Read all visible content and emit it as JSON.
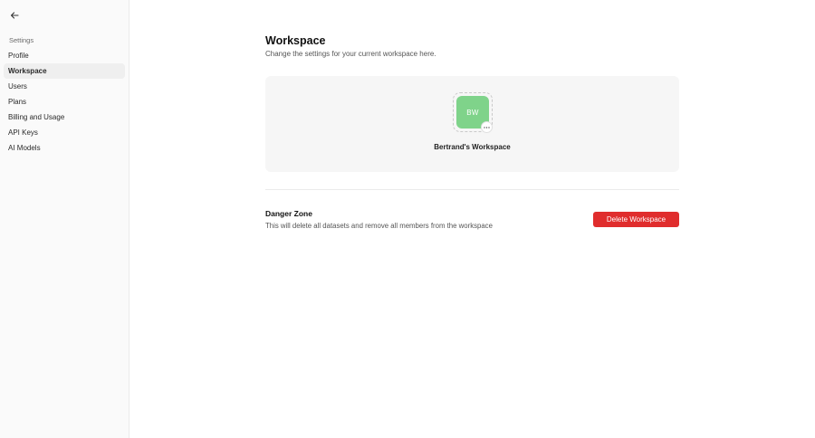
{
  "sidebar": {
    "back_icon": "arrow-left-icon",
    "section_label": "Settings",
    "items": [
      {
        "label": "Profile",
        "active": false
      },
      {
        "label": "Workspace",
        "active": true
      },
      {
        "label": "Users",
        "active": false
      },
      {
        "label": "Plans",
        "active": false
      },
      {
        "label": "Billing and Usage",
        "active": false
      },
      {
        "label": "API Keys",
        "active": false
      },
      {
        "label": "AI Models",
        "active": false
      }
    ]
  },
  "main": {
    "title": "Workspace",
    "subtitle": "Change the settings for your current workspace here.",
    "workspace_card": {
      "avatar_initials": "BW",
      "avatar_color": "#7fd38a",
      "menu_icon": "ellipsis-icon",
      "name": "Bertrand's Workspace"
    },
    "danger_zone": {
      "title": "Danger Zone",
      "description": "This will delete all datasets and remove all members from the workspace",
      "button_label": "Delete Workspace",
      "button_color": "#e02d2d"
    }
  }
}
